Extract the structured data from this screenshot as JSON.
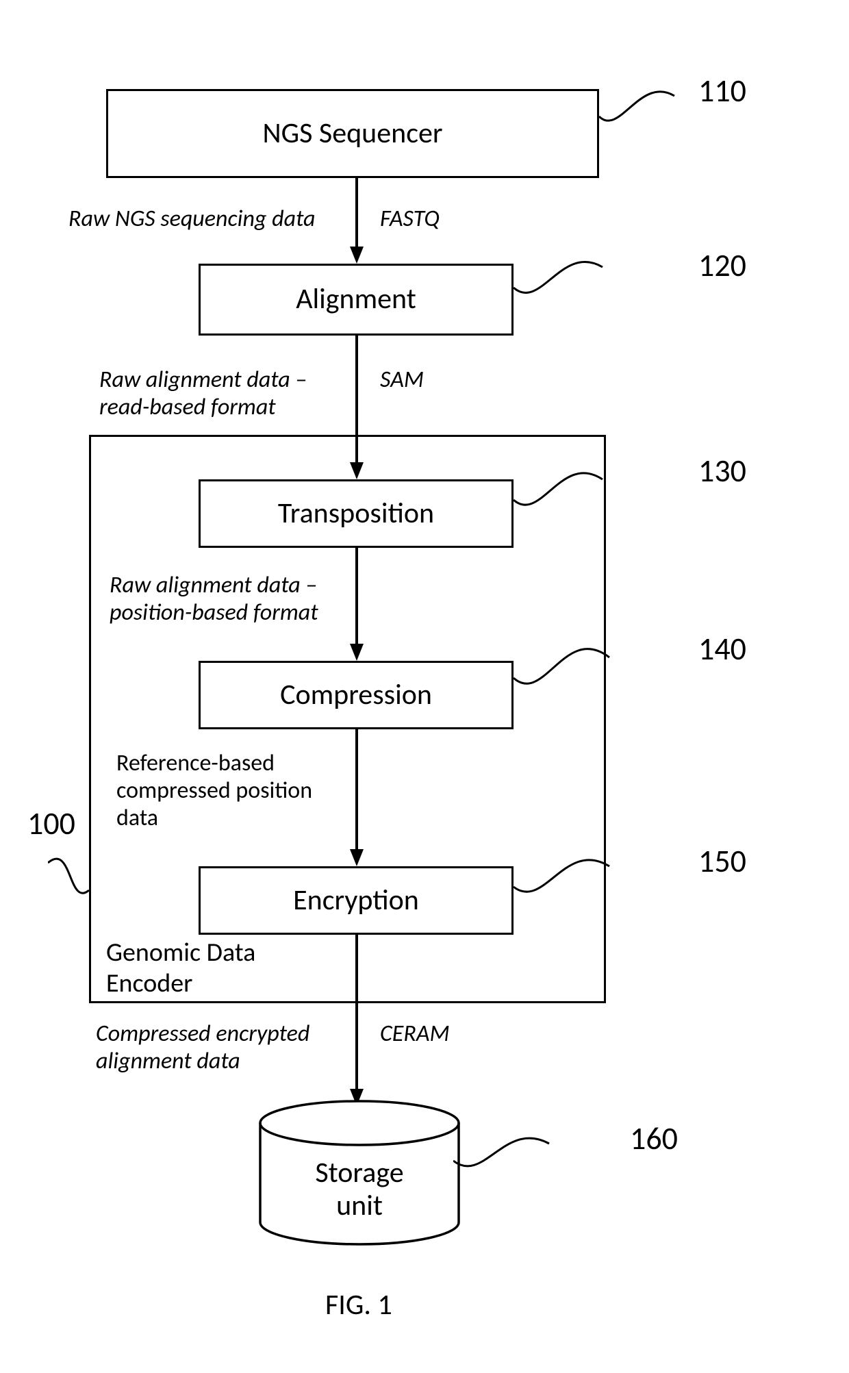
{
  "figure_caption": "FIG. 1",
  "boxes": {
    "sequencer": "NGS Sequencer",
    "alignment": "Alignment",
    "transposition": "Transposition",
    "compression": "Compression",
    "encryption": "Encryption",
    "storage_line1": "Storage",
    "storage_line2": "unit",
    "encoder_title_line1": "Genomic Data",
    "encoder_title_line2": "Encoder"
  },
  "arrow_labels": {
    "l1_left": "Raw NGS sequencing data",
    "l1_right": "FASTQ",
    "l2_left_line1": "Raw alignment data –",
    "l2_left_line2": "read-based format",
    "l2_right": "SAM",
    "l3_left_line1": "Raw alignment data –",
    "l3_left_line2": "position-based format",
    "l4_left_line1": "Reference-based",
    "l4_left_line2": "compressed position",
    "l4_left_line3": "data",
    "l5_left_line1": "Compressed encrypted",
    "l5_left_line2": "alignment data",
    "l5_right": "CERAM"
  },
  "numbers": {
    "n100": "100",
    "n110": "110",
    "n120": "120",
    "n130": "130",
    "n140": "140",
    "n150": "150",
    "n160": "160"
  }
}
